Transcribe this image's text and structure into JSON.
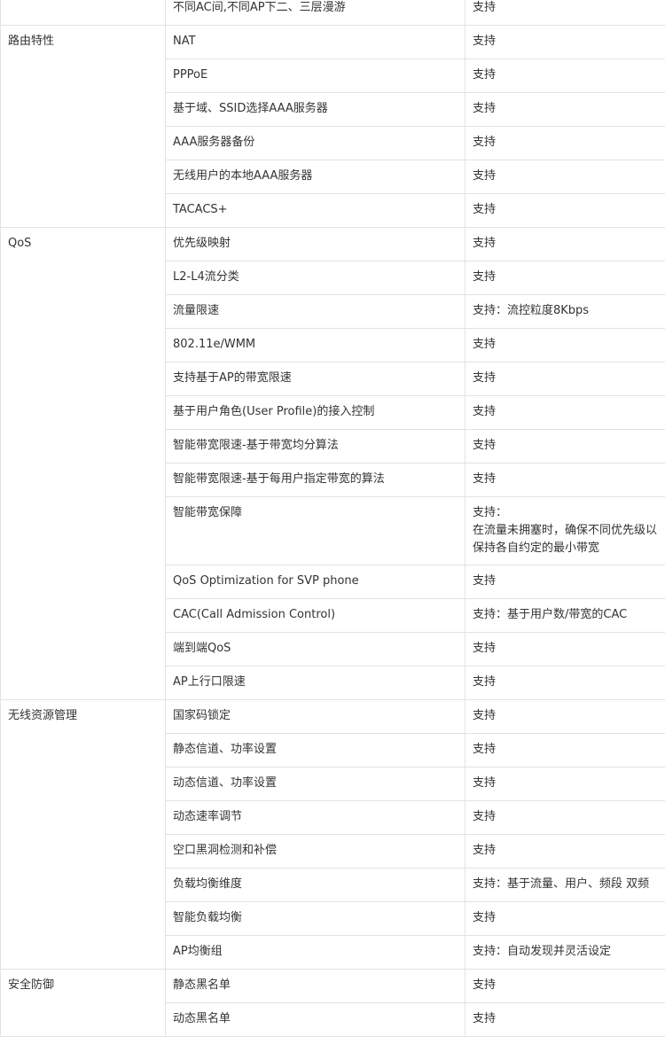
{
  "rows": [
    {
      "category": "",
      "feature": "不同AC间,不同AP下二、三层漫游",
      "value": "支持"
    },
    {
      "category": "路由特性",
      "feature": "NAT",
      "value": "支持"
    },
    {
      "category": "",
      "feature": "PPPoE",
      "value": "支持"
    },
    {
      "category": "",
      "feature": "基于域、SSID选择AAA服务器",
      "value": "支持"
    },
    {
      "category": "",
      "feature": "AAA服务器备份",
      "value": "支持"
    },
    {
      "category": "",
      "feature": "无线用户的本地AAA服务器",
      "value": "支持"
    },
    {
      "category": "",
      "feature": "TACACS+",
      "value": "支持"
    },
    {
      "category": "QoS",
      "feature": "优先级映射",
      "value": "支持"
    },
    {
      "category": "",
      "feature": "L2-L4流分类",
      "value": "支持"
    },
    {
      "category": "",
      "feature": "流量限速",
      "value": "支持：流控粒度8Kbps"
    },
    {
      "category": "",
      "feature": "802.11e/WMM",
      "value": "支持"
    },
    {
      "category": "",
      "feature": "支持基于AP的带宽限速",
      "value": "支持"
    },
    {
      "category": "",
      "feature": "基于用户角色(User Profile)的接入控制",
      "value": "支持"
    },
    {
      "category": "",
      "feature": "智能带宽限速-基于带宽均分算法",
      "value": "支持"
    },
    {
      "category": "",
      "feature": "智能带宽限速-基于每用户指定带宽的算法",
      "value": "支持"
    },
    {
      "category": "",
      "feature": "智能带宽保障",
      "value": "支持：\n在流量未拥塞时，确保不同优先级以保持各自约定的最小带宽"
    },
    {
      "category": "",
      "feature": "QoS Optimization for SVP phone",
      "value": "支持"
    },
    {
      "category": "",
      "feature": "CAC(Call Admission Control)",
      "value": "支持：基于用户数/带宽的CAC"
    },
    {
      "category": "",
      "feature": "端到端QoS",
      "value": "支持"
    },
    {
      "category": "",
      "feature": "AP上行口限速",
      "value": "支持"
    },
    {
      "category": "无线资源管理",
      "feature": "国家码锁定",
      "value": "支持"
    },
    {
      "category": "",
      "feature": "静态信道、功率设置",
      "value": "支持"
    },
    {
      "category": "",
      "feature": "动态信道、功率设置",
      "value": "支持"
    },
    {
      "category": "",
      "feature": "动态速率调节",
      "value": "支持"
    },
    {
      "category": "",
      "feature": "空口黑洞检测和补偿",
      "value": "支持"
    },
    {
      "category": "",
      "feature": "负载均衡维度",
      "value": "支持：基于流量、用户、频段 双频"
    },
    {
      "category": "",
      "feature": "智能负载均衡",
      "value": "支持"
    },
    {
      "category": "",
      "feature": "AP均衡组",
      "value": "支持：自动发现并灵活设定"
    },
    {
      "category": "安全防御",
      "feature": "静态黑名单",
      "value": "支持"
    },
    {
      "category": "",
      "feature": "动态黑名单",
      "value": "支持"
    }
  ],
  "groups": [
    {
      "start": 0,
      "span": 1
    },
    {
      "start": 1,
      "span": 6
    },
    {
      "start": 7,
      "span": 13
    },
    {
      "start": 20,
      "span": 8
    },
    {
      "start": 28,
      "span": 2
    }
  ]
}
